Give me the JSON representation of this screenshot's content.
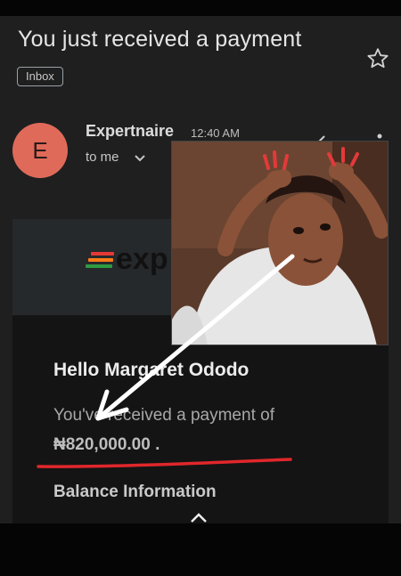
{
  "email": {
    "subject": "You just received a payment",
    "label_chip": "Inbox",
    "avatar_letter": "E",
    "sender": "Expertnaire",
    "time": "12:40 AM",
    "recipient": "to me"
  },
  "body": {
    "logo_text": "exp",
    "greeting": "Hello Margaret Ododo",
    "message": "You've received a payment of",
    "amount": "₦820,000.00 .",
    "section_title": "Balance Information"
  },
  "icons": [
    "star-icon",
    "chevron-down-icon",
    "reply-icon",
    "more-vert-icon",
    "chevron-up-icon",
    "expertnaire-logo-icon",
    "arrow-annotation",
    "underline-annotation"
  ],
  "colors": {
    "avatar": "#e06a5a",
    "annotation_red": "#e0272b",
    "annotation_arrow": "#ffffff",
    "logo_red": "#e53935",
    "logo_orange": "#ff7a18",
    "logo_green": "#2e9b41"
  }
}
